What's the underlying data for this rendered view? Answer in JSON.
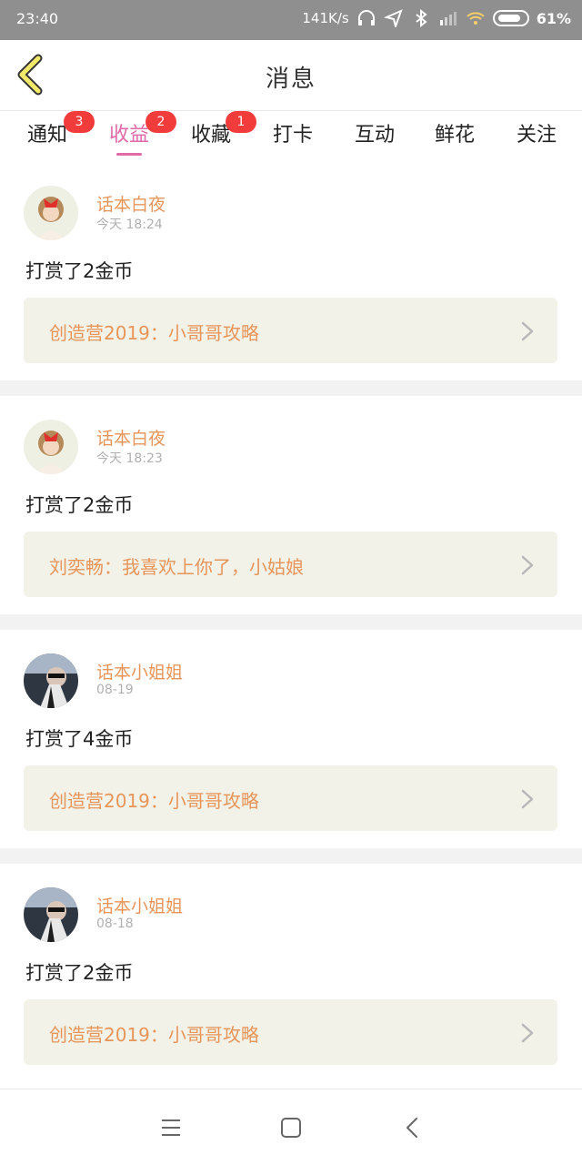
{
  "status_bar": {
    "time": "23:40",
    "speed": "141K/s",
    "battery": "61%",
    "icons": [
      "headphones-icon",
      "location-icon",
      "bluetooth-icon",
      "signal-icon",
      "wifi-icon",
      "battery-icon"
    ]
  },
  "header": {
    "title": "消息",
    "back_icon": "chevron-left-icon"
  },
  "tabs": [
    {
      "label": "通知",
      "badge": "3"
    },
    {
      "label": "收益",
      "badge": "2",
      "active": true
    },
    {
      "label": "收藏",
      "badge": "1"
    },
    {
      "label": "打卡"
    },
    {
      "label": "互动"
    },
    {
      "label": "鲜花"
    },
    {
      "label": "关注"
    }
  ],
  "messages": [
    {
      "user": "话本白夜",
      "time": "今天 18:24",
      "action": "打赏了2金币",
      "card": "创造营2019：小哥哥攻略"
    },
    {
      "user": "话本白夜",
      "time": "今天 18:23",
      "action": "打赏了2金币",
      "card": "刘奕畅：我喜欢上你了，小姑娘"
    },
    {
      "user": "话本小姐姐",
      "time": "08-19",
      "action": "打赏了4金币",
      "card": "创造营2019：小哥哥攻略"
    },
    {
      "user": "话本小姐姐",
      "time": "08-18",
      "action": "打赏了2金币",
      "card": "创造营2019：小哥哥攻略"
    }
  ],
  "colors": {
    "accent_pink": "#e06aa8",
    "username_orange": "#e8955a",
    "badge_red": "#f23b3b",
    "card_bg": "#f2f2e8",
    "back_icon_yellow": "#f2e86a"
  },
  "nav_bar": {
    "icons": [
      "menu-icon",
      "home-square-icon",
      "back-triangle-icon"
    ]
  }
}
